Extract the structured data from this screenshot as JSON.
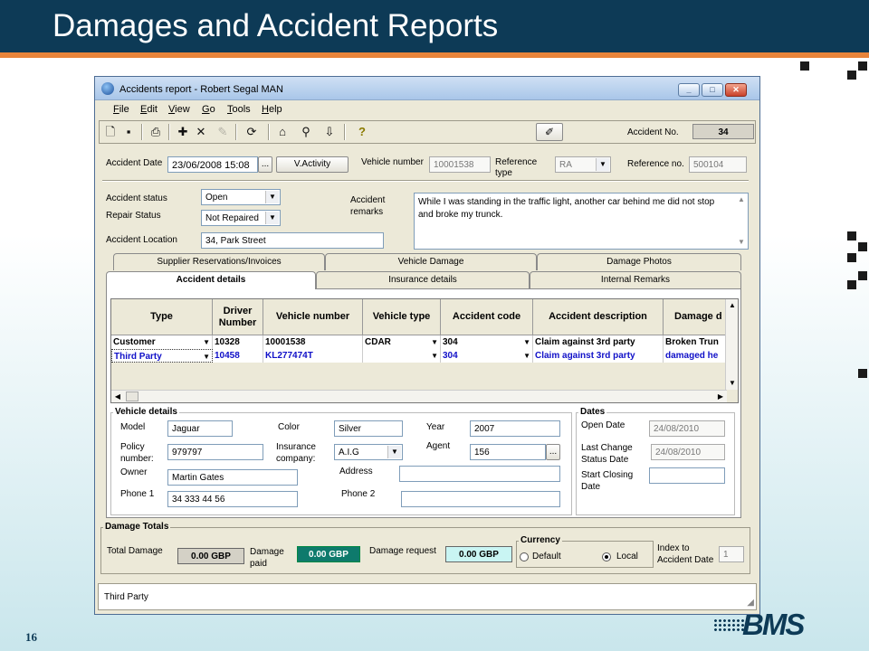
{
  "slide": {
    "title": "Damages and Accident Reports",
    "page_number": "16",
    "logo": "BMS"
  },
  "window": {
    "title": "Accidents report - Robert Segal MAN",
    "menu": [
      "File",
      "Edit",
      "View",
      "Go",
      "Tools",
      "Help"
    ],
    "accident_no_label": "Accident No.",
    "accident_no": "34"
  },
  "form": {
    "accident_date_label": "Accident Date",
    "accident_date": "23/06/2008 15:08",
    "ellipsis": "...",
    "vactivity_label": "V.Activity",
    "vehicle_number_label": "Vehicle number",
    "vehicle_number": "10001538",
    "reference_type_label": "Reference type",
    "reference_type": "RA",
    "reference_no_label": "Reference no.",
    "reference_no": "500104",
    "accident_status_label": "Accident status",
    "accident_status": "Open",
    "repair_status_label": "Repair Status",
    "repair_status": "Not Repaired",
    "accident_location_label": "Accident Location",
    "accident_location": "34, Park Street",
    "accident_remarks_label": "Accident remarks",
    "accident_remarks": "While I was standing in the traffic light, another car behind me did not stop and broke my trunck."
  },
  "tabs_back": [
    "Supplier Reservations/Invoices",
    "Vehicle Damage",
    "Damage Photos"
  ],
  "tabs_front": [
    "Accident details",
    "Insurance details",
    "Internal Remarks"
  ],
  "grid": {
    "headers": [
      "Type",
      "Driver Number",
      "Vehicle number",
      "Vehicle type",
      "Accident code",
      "Accident description",
      "Damage d"
    ],
    "rows": [
      [
        "Customer",
        "10328",
        "10001538",
        "CDAR",
        "304",
        "Claim against 3rd party",
        "Broken Trun"
      ],
      [
        "Third Party",
        "10458",
        "KL277474T",
        "",
        "304",
        "Claim against 3rd party",
        "damaged he"
      ]
    ]
  },
  "vehicle_details": {
    "title": "Vehicle details",
    "model_label": "Model",
    "model": "Jaguar",
    "color_label": "Color",
    "color": "Silver",
    "year_label": "Year",
    "year": "2007",
    "policy_label": "Policy number:",
    "policy": "979797",
    "insurance_label": "Insurance company:",
    "insurance": "A.I.G",
    "agent_label": "Agent",
    "agent": "156",
    "owner_label": "Owner",
    "owner": "Martin Gates",
    "address_label": "Address",
    "address": "",
    "phone1_label": "Phone 1",
    "phone1": "34 333 44 56",
    "phone2_label": "Phone 2",
    "phone2": ""
  },
  "dates": {
    "title": "Dates",
    "open_date_label": "Open Date",
    "open_date": "24/08/2010",
    "last_change_label": "Last Change Status Date",
    "last_change": "24/08/2010",
    "start_closing_label": "Start Closing Date",
    "start_closing": ""
  },
  "damage_totals": {
    "title": "Damage Totals",
    "total_damage_label": "Total Damage",
    "total_damage": "0.00 GBP",
    "damage_paid_label": "Damage paid",
    "damage_paid": "0.00 GBP",
    "damage_request_label": "Damage request",
    "damage_request": "0.00 GBP",
    "currency_title": "Currency",
    "currency_default": "Default",
    "currency_local": "Local",
    "index_label": "Index to Accident Date",
    "index": "1"
  },
  "status_text": "Third Party"
}
